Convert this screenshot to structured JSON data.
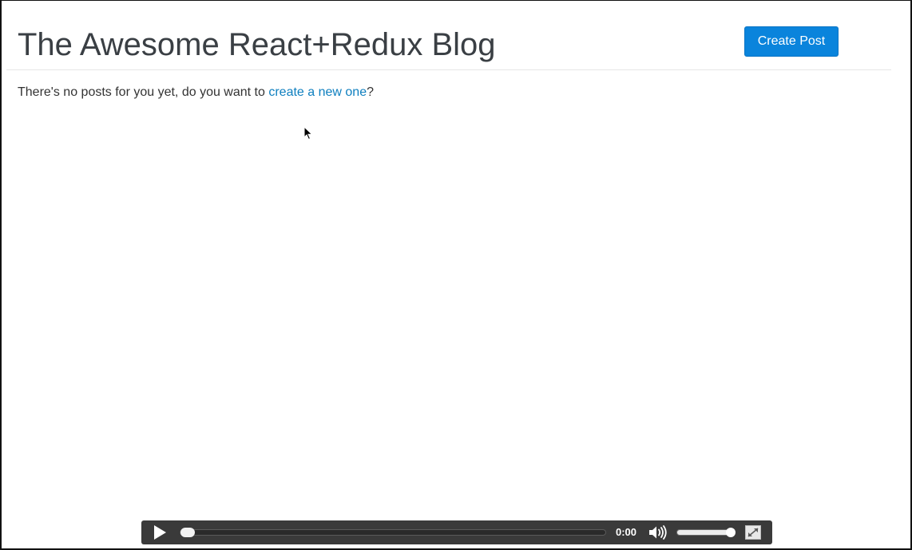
{
  "header": {
    "title": "The Awesome React+Redux Blog",
    "create_button_label": "Create Post"
  },
  "main": {
    "empty_message_prefix": "There's no posts for you yet, do you want to ",
    "empty_message_link": "create a new one",
    "empty_message_suffix": "?"
  },
  "video_player": {
    "time": "0:00",
    "progress": 0.0,
    "volume": 1.0,
    "icons": {
      "play": "play-icon",
      "volume": "volume-icon",
      "fullscreen": "fullscreen-icon"
    }
  },
  "colors": {
    "accent": "#0a84dc",
    "link": "#0e7fbf",
    "title": "#3a3f44",
    "player_bg": "#3a3a3a"
  }
}
